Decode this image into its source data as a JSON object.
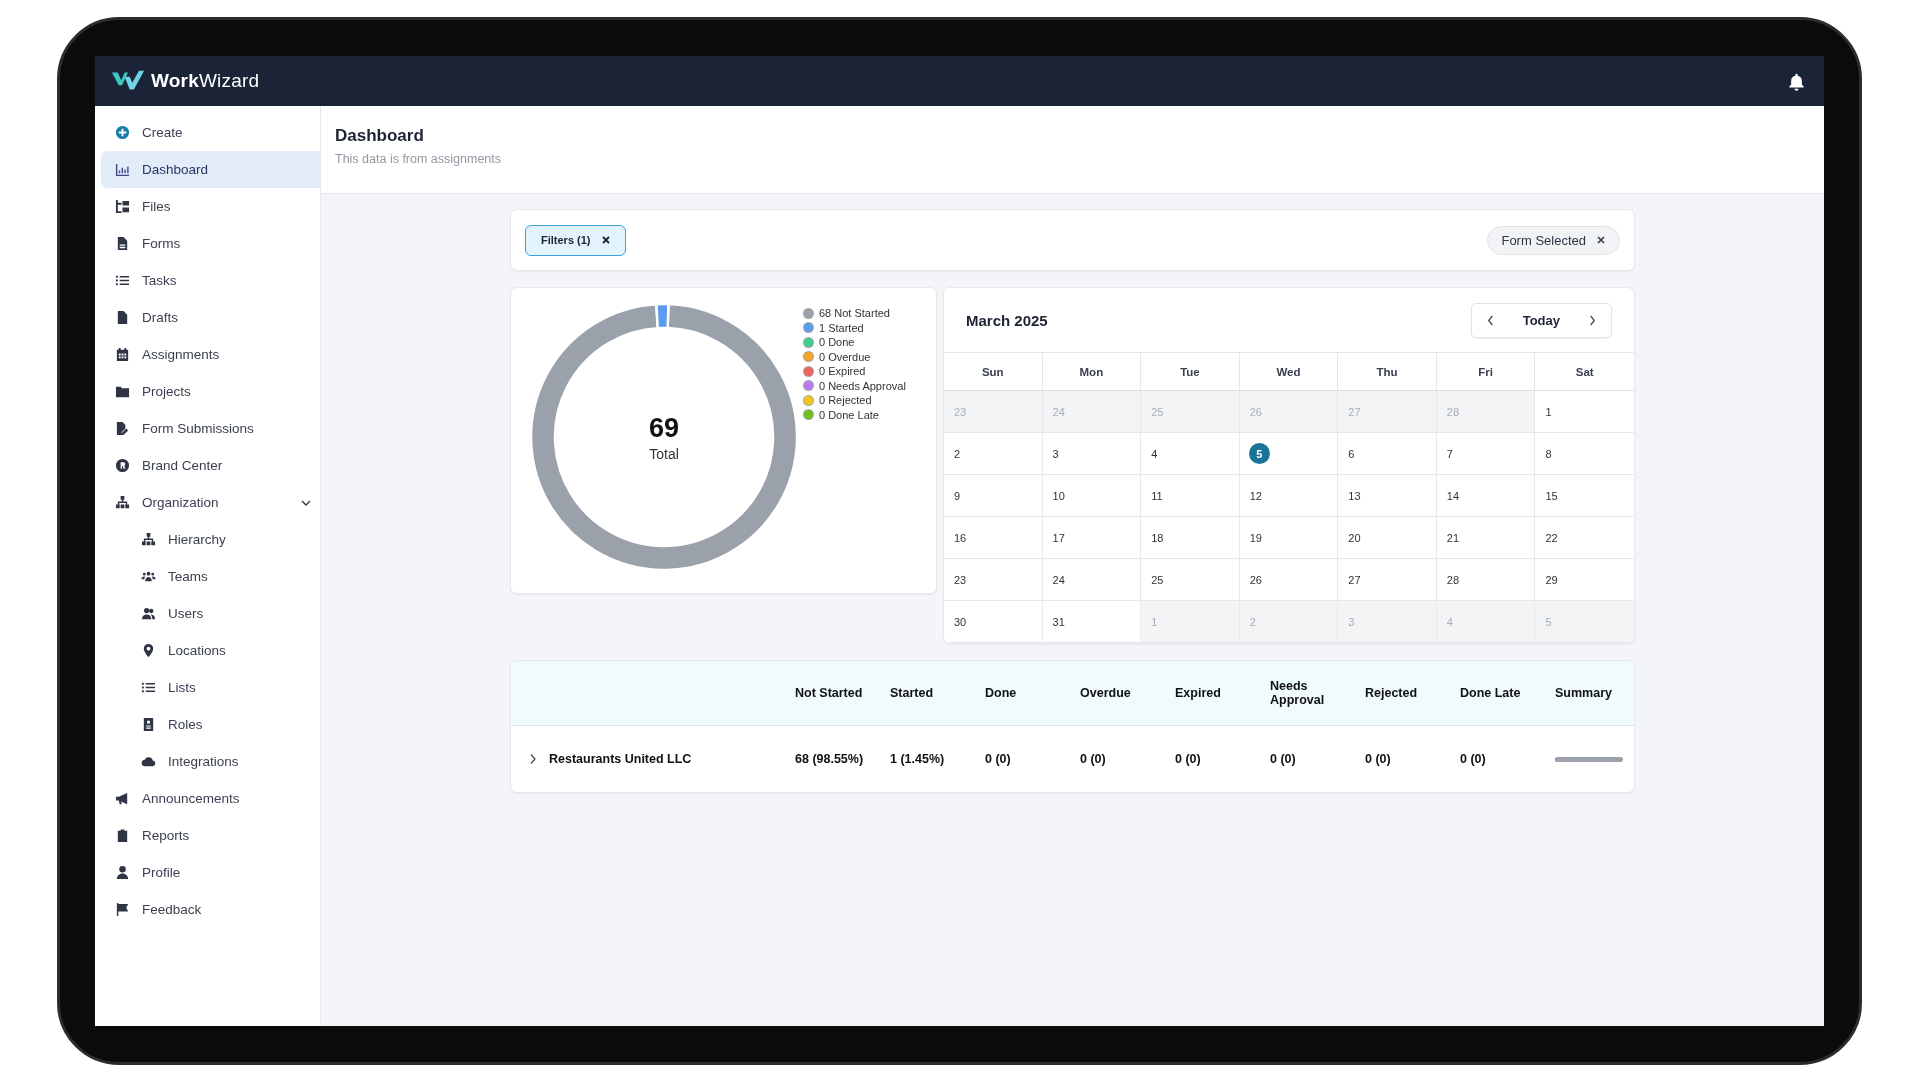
{
  "app": {
    "brand": "**Work**Wizard"
  },
  "sidebar": {
    "items": [
      {
        "label": "Create",
        "selected": false
      },
      {
        "label": "Dashboard",
        "selected": true
      },
      {
        "label": "Files",
        "selected": false
      },
      {
        "label": "Forms",
        "selected": false
      },
      {
        "label": "Tasks",
        "selected": false
      },
      {
        "label": "Drafts",
        "selected": false
      },
      {
        "label": "Assignments",
        "selected": false
      },
      {
        "label": "Projects",
        "selected": false
      },
      {
        "label": "Form Submissions",
        "selected": false
      },
      {
        "label": "Brand Center",
        "selected": false
      },
      {
        "label": "Organization",
        "selected": false,
        "expanded": true,
        "children": [
          {
            "label": "Hierarchy",
            "selected": false
          },
          {
            "label": "Teams",
            "selected": false
          },
          {
            "label": "Users",
            "selected": false
          },
          {
            "label": "Locations",
            "selected": false
          },
          {
            "label": "Lists",
            "selected": false
          },
          {
            "label": "Roles",
            "selected": false
          },
          {
            "label": "Integrations",
            "selected": false
          }
        ]
      },
      {
        "label": "Announcements",
        "selected": false
      },
      {
        "label": "Reports",
        "selected": false
      },
      {
        "label": "Profile",
        "selected": false
      },
      {
        "label": "Feedback",
        "selected": false
      }
    ]
  },
  "page": {
    "title": "Dashboard",
    "subtitle": "This data is from assignments"
  },
  "filters": {
    "filter_chip": "Filters (1)",
    "form_chip": "Form Selected"
  },
  "donut": {
    "total": "69",
    "total_label": "Total",
    "chart_data": {
      "type": "donut",
      "categories": [
        "68 Not Started",
        "1 Started",
        "0 Done",
        "0 Overdue",
        "0 Expired",
        "0 Needs Approval",
        "0 Rejected",
        "0 Done Late"
      ],
      "values": [
        68,
        1,
        0,
        0,
        0,
        0,
        0,
        0
      ]
    },
    "legend": [
      {
        "color": "#9aa1ab"
      },
      {
        "color": "#5b9cf0"
      },
      {
        "color": "#3ecf8e"
      },
      {
        "color": "#f5a524"
      },
      {
        "color": "#f06262"
      },
      {
        "color": "#b77cf5"
      },
      {
        "color": "#f5c518"
      },
      {
        "color": "#6fc21e"
      }
    ]
  },
  "calendar": {
    "month": "March 2025",
    "today_button": "Today",
    "weekdays": [
      "Sun",
      "Mon",
      "Tue",
      "Wed",
      "Thu",
      "Fri",
      "Sat"
    ],
    "weeks": [
      [
        {
          "day": "23",
          "outside": true,
          "today": false
        },
        {
          "day": "24",
          "outside": true,
          "today": false
        },
        {
          "day": "25",
          "outside": true,
          "today": false
        },
        {
          "day": "26",
          "outside": true,
          "today": false
        },
        {
          "day": "27",
          "outside": true,
          "today": false
        },
        {
          "day": "28",
          "outside": true,
          "today": false
        },
        {
          "day": "1",
          "outside": false,
          "today": false
        }
      ],
      [
        {
          "day": "2",
          "outside": false,
          "today": false
        },
        {
          "day": "3",
          "outside": false,
          "today": false
        },
        {
          "day": "4",
          "outside": false,
          "today": false
        },
        {
          "day": "5",
          "outside": false,
          "today": true
        },
        {
          "day": "6",
          "outside": false,
          "today": false
        },
        {
          "day": "7",
          "outside": false,
          "today": false
        },
        {
          "day": "8",
          "outside": false,
          "today": false
        }
      ],
      [
        {
          "day": "9",
          "outside": false,
          "today": false
        },
        {
          "day": "10",
          "outside": false,
          "today": false
        },
        {
          "day": "11",
          "outside": false,
          "today": false
        },
        {
          "day": "12",
          "outside": false,
          "today": false
        },
        {
          "day": "13",
          "outside": false,
          "today": false
        },
        {
          "day": "14",
          "outside": false,
          "today": false
        },
        {
          "day": "15",
          "outside": false,
          "today": false
        }
      ],
      [
        {
          "day": "16",
          "outside": false,
          "today": false
        },
        {
          "day": "17",
          "outside": false,
          "today": false
        },
        {
          "day": "18",
          "outside": false,
          "today": false
        },
        {
          "day": "19",
          "outside": false,
          "today": false
        },
        {
          "day": "20",
          "outside": false,
          "today": false
        },
        {
          "day": "21",
          "outside": false,
          "today": false
        },
        {
          "day": "22",
          "outside": false,
          "today": false
        }
      ],
      [
        {
          "day": "23",
          "outside": false,
          "today": false
        },
        {
          "day": "24",
          "outside": false,
          "today": false
        },
        {
          "day": "25",
          "outside": false,
          "today": false
        },
        {
          "day": "26",
          "outside": false,
          "today": false
        },
        {
          "day": "27",
          "outside": false,
          "today": false
        },
        {
          "day": "28",
          "outside": false,
          "today": false
        },
        {
          "day": "29",
          "outside": false,
          "today": false
        }
      ],
      [
        {
          "day": "30",
          "outside": false,
          "today": false
        },
        {
          "day": "31",
          "outside": false,
          "today": false
        },
        {
          "day": "1",
          "outside": true,
          "today": false
        },
        {
          "day": "2",
          "outside": true,
          "today": false
        },
        {
          "day": "3",
          "outside": true,
          "today": false
        },
        {
          "day": "4",
          "outside": true,
          "today": false
        },
        {
          "day": "5",
          "outside": true,
          "today": false
        }
      ]
    ]
  },
  "table": {
    "columns": [
      "Not Started",
      "Started",
      "Done",
      "Overdue",
      "Expired",
      "Needs Approval",
      "Rejected",
      "Done Late",
      "Summary"
    ],
    "rows": [
      {
        "name": "Restaurants United LLC",
        "expanded": false,
        "cells": [
          "68 (98.55%)",
          "1 (1.45%)",
          "0 (0)",
          "0 (0)",
          "0 (0)",
          "0 (0)",
          "0 (0)",
          "0 (0)"
        ],
        "summary": {
          "level": 0.0145
        }
      }
    ]
  }
}
